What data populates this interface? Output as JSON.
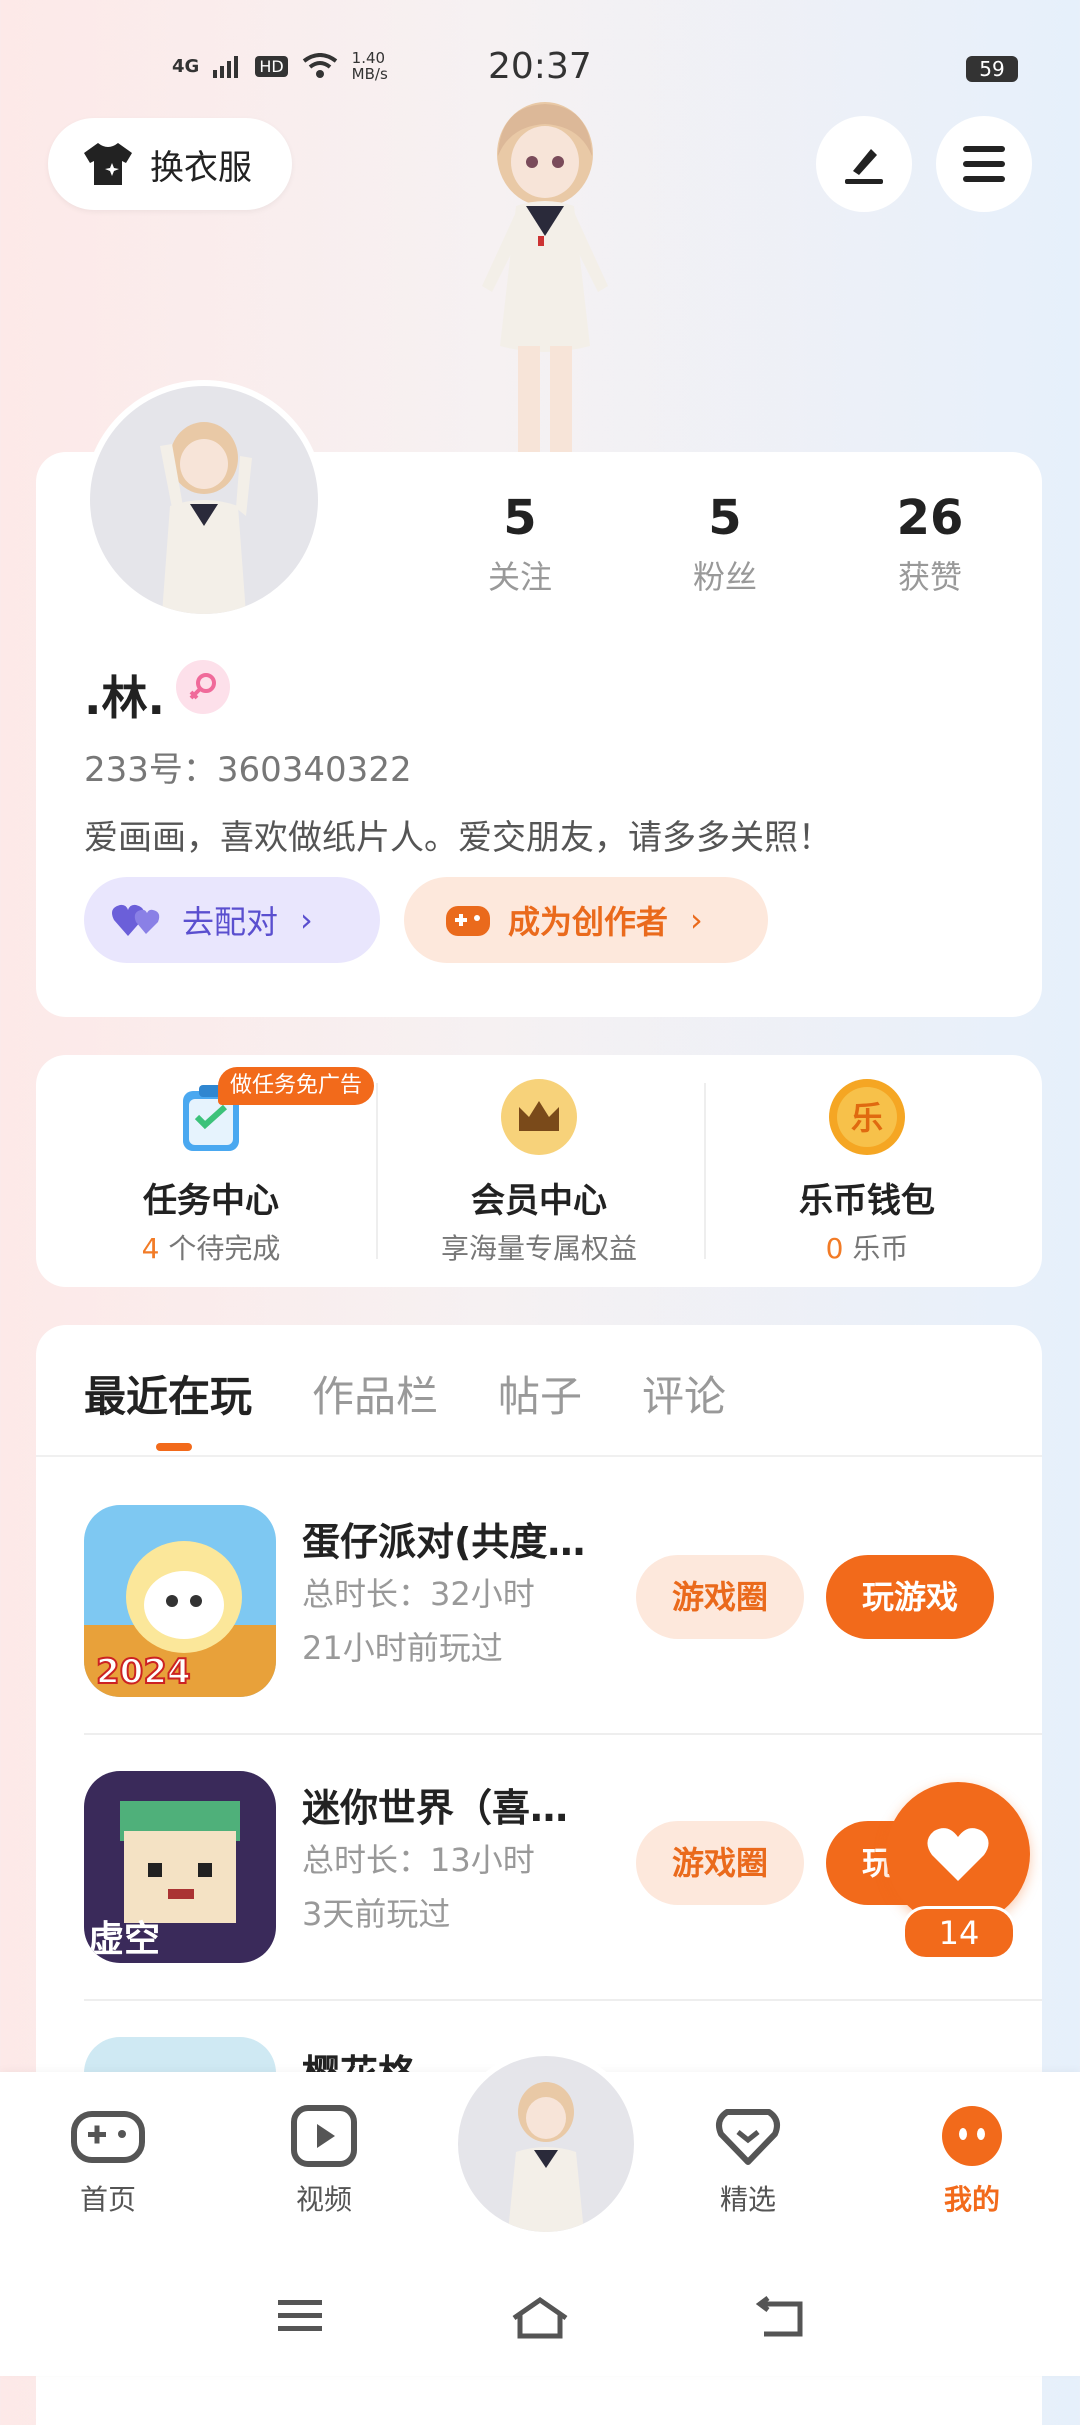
{
  "status_bar": {
    "time": "20:37",
    "network": "4G",
    "hd": "HD",
    "speed_value": "1.40",
    "speed_unit": "MB/s",
    "battery": "59"
  },
  "top_bar": {
    "dress_button_label": "换衣服",
    "edit_icon": "pen-icon",
    "menu_icon": "menu-icon"
  },
  "profile": {
    "nickname": ".林.",
    "gender_icon": "female-icon",
    "uid": "233号：360340322",
    "bio": "爱画画，喜欢做纸片人。爱交朋友，请多多关照！",
    "stats": [
      {
        "value": "5",
        "label": "关注"
      },
      {
        "value": "5",
        "label": "粉丝"
      },
      {
        "value": "26",
        "label": "获赞"
      }
    ],
    "match_button": "去配对",
    "creator_button": "成为创作者"
  },
  "services": [
    {
      "title": "任务中心",
      "badge": "做任务免广告",
      "count": "4",
      "sub": " 个待完成",
      "icon": "task-icon"
    },
    {
      "title": "会员中心",
      "sub": "享海量专属权益",
      "icon": "crown-icon"
    },
    {
      "title": "乐币钱包",
      "count": "0",
      "sub": " 乐币",
      "icon": "coin-icon",
      "coin_glyph": "乐"
    }
  ],
  "tabs": [
    "最近在玩",
    "作品栏",
    "帖子",
    "评论"
  ],
  "games": [
    {
      "name": "蛋仔派对(共度…",
      "duration": "总时长：32小时",
      "last_played": "21小时前玩过",
      "circle_btn": "游戏圈",
      "play_btn": "玩游戏",
      "icon_text": "2024"
    },
    {
      "name": "迷你世界（喜…",
      "duration": "总时长：13小时",
      "last_played": "3天前玩过",
      "circle_btn": "游戏圈",
      "play_btn": "玩游戏",
      "icon_text": "虚空"
    }
  ],
  "partial_game_name": "樱花格…",
  "float_like": {
    "count": "14"
  },
  "bottom_nav": [
    {
      "label": "首页",
      "icon": "gamepad-icon"
    },
    {
      "label": "视频",
      "icon": "video-icon"
    },
    {
      "label": "精选",
      "icon": "heart-badge-icon"
    },
    {
      "label": "我的",
      "icon": "me-icon"
    }
  ],
  "colors": {
    "accent": "#f26a1b",
    "match_purple": "#5a4fcf"
  }
}
